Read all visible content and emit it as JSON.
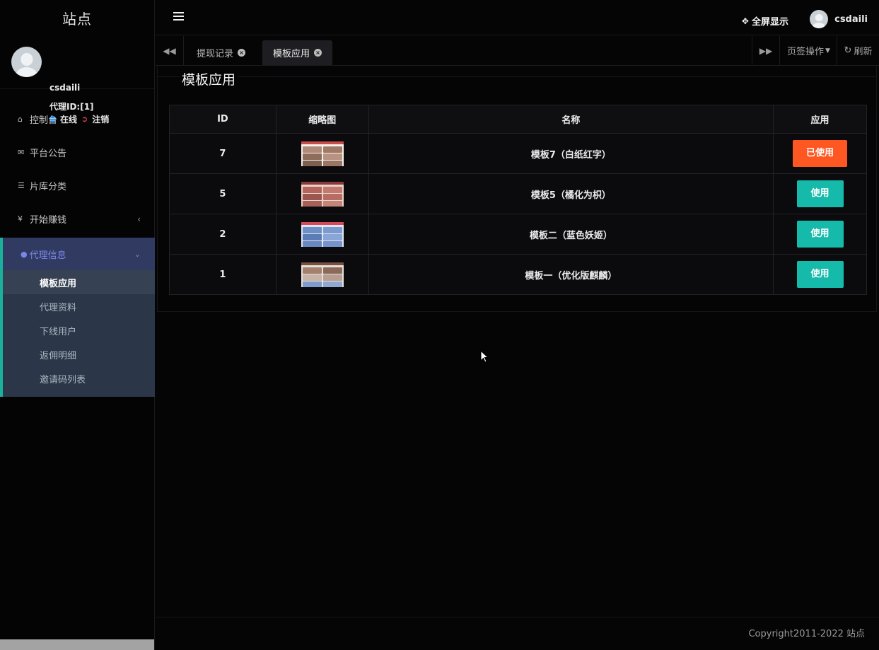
{
  "sidebar": {
    "brand": "站点",
    "user": {
      "name": "csdaili",
      "agent_id": "代理ID:[1]",
      "status": "在线",
      "logout": "注销"
    },
    "items": [
      {
        "label": "控制台",
        "icon": "home-icon"
      },
      {
        "label": "平台公告",
        "icon": "bullhorn-icon"
      },
      {
        "label": "片库分类",
        "icon": "list-icon"
      },
      {
        "label": "开始赚钱",
        "icon": "yen-icon"
      }
    ],
    "group": {
      "label": "代理信息",
      "icon": "user-icon",
      "children": [
        "模板应用",
        "代理资料",
        "下线用户",
        "返佣明细",
        "邀请码列表"
      ]
    }
  },
  "header": {
    "fullscreen_label": "全屏显示",
    "username": "csdaili"
  },
  "tabs": {
    "items": [
      {
        "label": "提现记录"
      },
      {
        "label": "模板应用"
      }
    ],
    "ops_label": "页签操作",
    "refresh_label": "刷新"
  },
  "main": {
    "title": "模板应用",
    "table": {
      "headers": [
        "ID",
        "缩略图",
        "名称",
        "应用"
      ],
      "rows": [
        {
          "id": "7",
          "name": "模板7（白纸红字）",
          "action": "已使用"
        },
        {
          "id": "5",
          "name": "模板5（橘化为枳）",
          "action": "使用"
        },
        {
          "id": "2",
          "name": "模板二（蓝色妖姬）",
          "action": "使用"
        },
        {
          "id": "1",
          "name": "模板一（优化版麒麟）",
          "action": "使用"
        }
      ]
    }
  },
  "footer": {
    "copyright": "Copyright2011-2022 站点"
  },
  "colors": {
    "accent_teal": "#16baaa",
    "accent_orange": "#ff5722",
    "nav_active": "#7a86e8"
  }
}
